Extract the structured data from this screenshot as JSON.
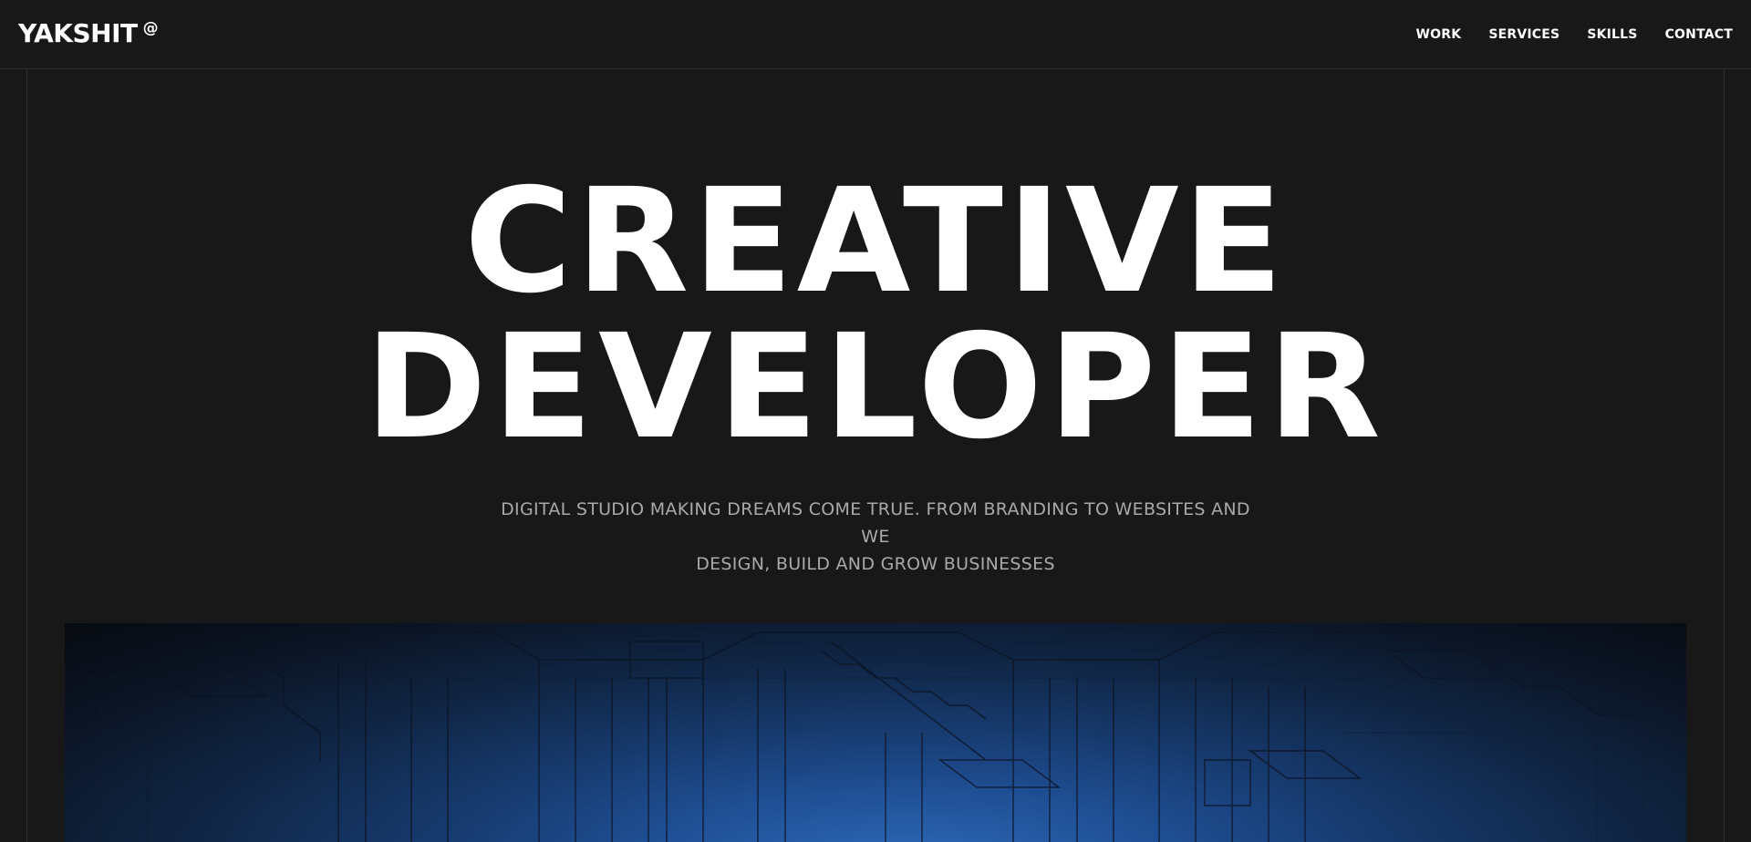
{
  "header": {
    "logo": "YAKSHIT",
    "logo_mark": "@",
    "nav": [
      "WORK",
      "SERVICES",
      "SKILLS",
      "CONTACT"
    ]
  },
  "hero": {
    "title_line1": "CREATIVE",
    "title_line2": "DEVELOPER",
    "subtitle_line1": "DIGITAL STUDIO MAKING DREAMS COME TRUE. FROM BRANDING TO WEBSITES AND WE",
    "subtitle_line2": "DESIGN, BUILD AND GROW BUSINESSES"
  },
  "colors": {
    "background": "#181818",
    "text": "#ffffff",
    "subtitle": "#a9a9a9",
    "image_accent": "#2e69b8"
  }
}
